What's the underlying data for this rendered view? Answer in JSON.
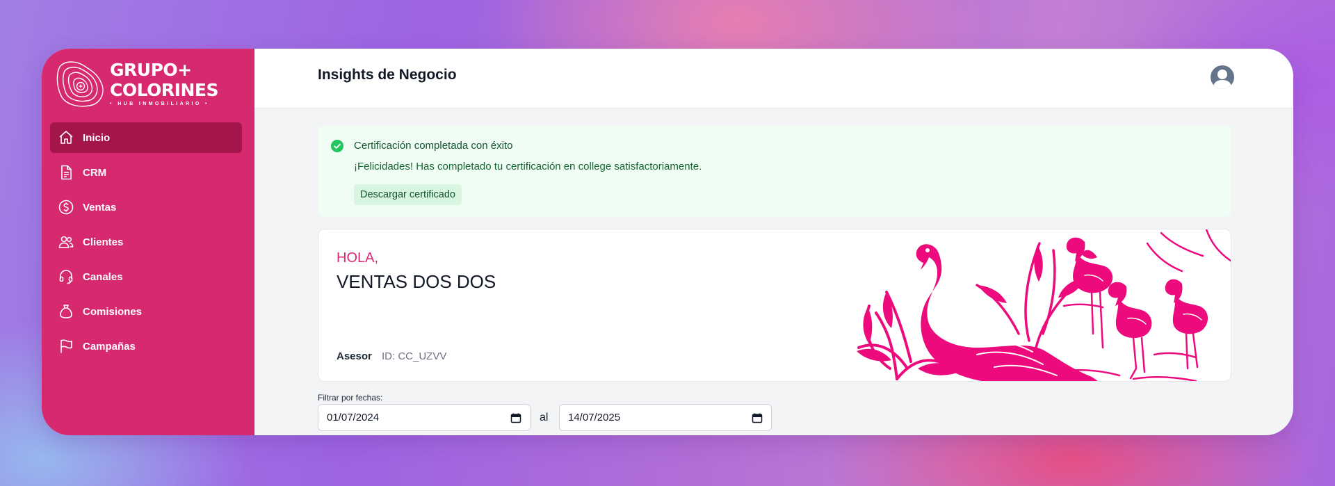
{
  "brand": {
    "line1": "GRUPO+",
    "line2": "COLORINES",
    "tagline": "• HUB INMOBILIARIO •",
    "color": "#d6296f"
  },
  "sidebar": {
    "items": [
      {
        "label": "Inicio",
        "icon": "home-icon",
        "active": true
      },
      {
        "label": "CRM",
        "icon": "document-icon"
      },
      {
        "label": "Ventas",
        "icon": "dollar-icon"
      },
      {
        "label": "Clientes",
        "icon": "users-icon"
      },
      {
        "label": "Canales",
        "icon": "headset-icon"
      },
      {
        "label": "Comisiones",
        "icon": "money-bag-icon"
      },
      {
        "label": "Campañas",
        "icon": "flag-icon"
      }
    ]
  },
  "header": {
    "title": "Insights de Negocio",
    "avatar_icon": "user-avatar-icon"
  },
  "alert": {
    "icon": "check-circle-icon",
    "title": "Certificación completada con éxito",
    "message": "¡Felicidades! Has completado tu certificación en college satisfactoriamente.",
    "button": "Descargar certificado",
    "color": "#22c55e"
  },
  "welcome": {
    "greeting": "HOLA,",
    "name": "VENTAS DOS DOS",
    "role": "Asesor",
    "id": "ID: CC_UZVV",
    "illustration": "flamingo-illustration"
  },
  "filter": {
    "label": "Filtrar por fechas:",
    "from": "01/07/2024",
    "separator": "al",
    "to": "14/07/2025"
  }
}
